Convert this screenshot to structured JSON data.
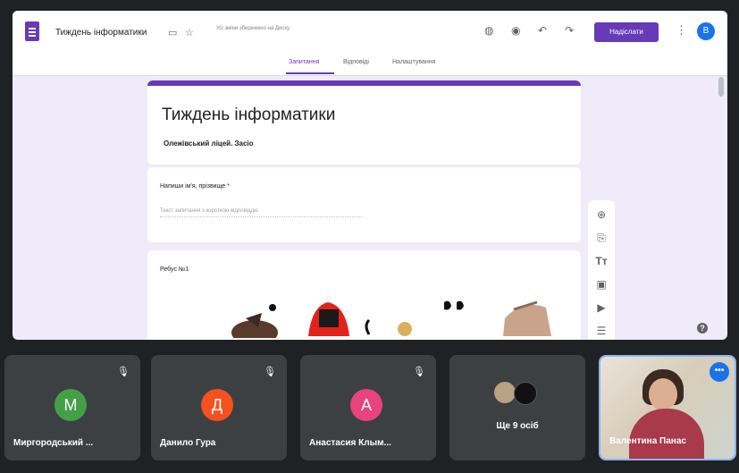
{
  "form_editor": {
    "doc_title": "Тиждень інформатики",
    "save_status": "Усі зміни збережено на Диску",
    "send_label": "Надіслати",
    "account_initial": "В",
    "tabs": [
      {
        "label": "Запитання",
        "active": true
      },
      {
        "label": "Відповіді",
        "active": false
      },
      {
        "label": "Налаштування",
        "active": false
      }
    ],
    "form": {
      "title": "Тиждень інформатики",
      "description": "Олежівський ліцей. Засіо"
    },
    "questions": [
      {
        "label": "Напиши ім'я, прізвище *",
        "placeholder": "Текст запитання з короткою відповіддю"
      },
      {
        "label": "Ребус №1"
      }
    ],
    "side_tools": [
      "add-question-icon",
      "import-questions-icon",
      "add-title-icon",
      "add-image-icon",
      "add-video-icon",
      "add-section-icon"
    ],
    "accent_color": "#673ab7"
  },
  "meet": {
    "participants": [
      {
        "name": "Миргородський ...",
        "initial": "М",
        "color": "#43a047",
        "muted": true
      },
      {
        "name": "Данило Гура",
        "initial": "Д",
        "color": "#f4511e",
        "muted": true
      },
      {
        "name": "Анастасия Клым...",
        "initial": "А",
        "color": "#e8437a",
        "muted": true
      }
    ],
    "more_label": "Ще 9 осіб",
    "active_speaker": {
      "name": "Валентина Панас"
    }
  }
}
